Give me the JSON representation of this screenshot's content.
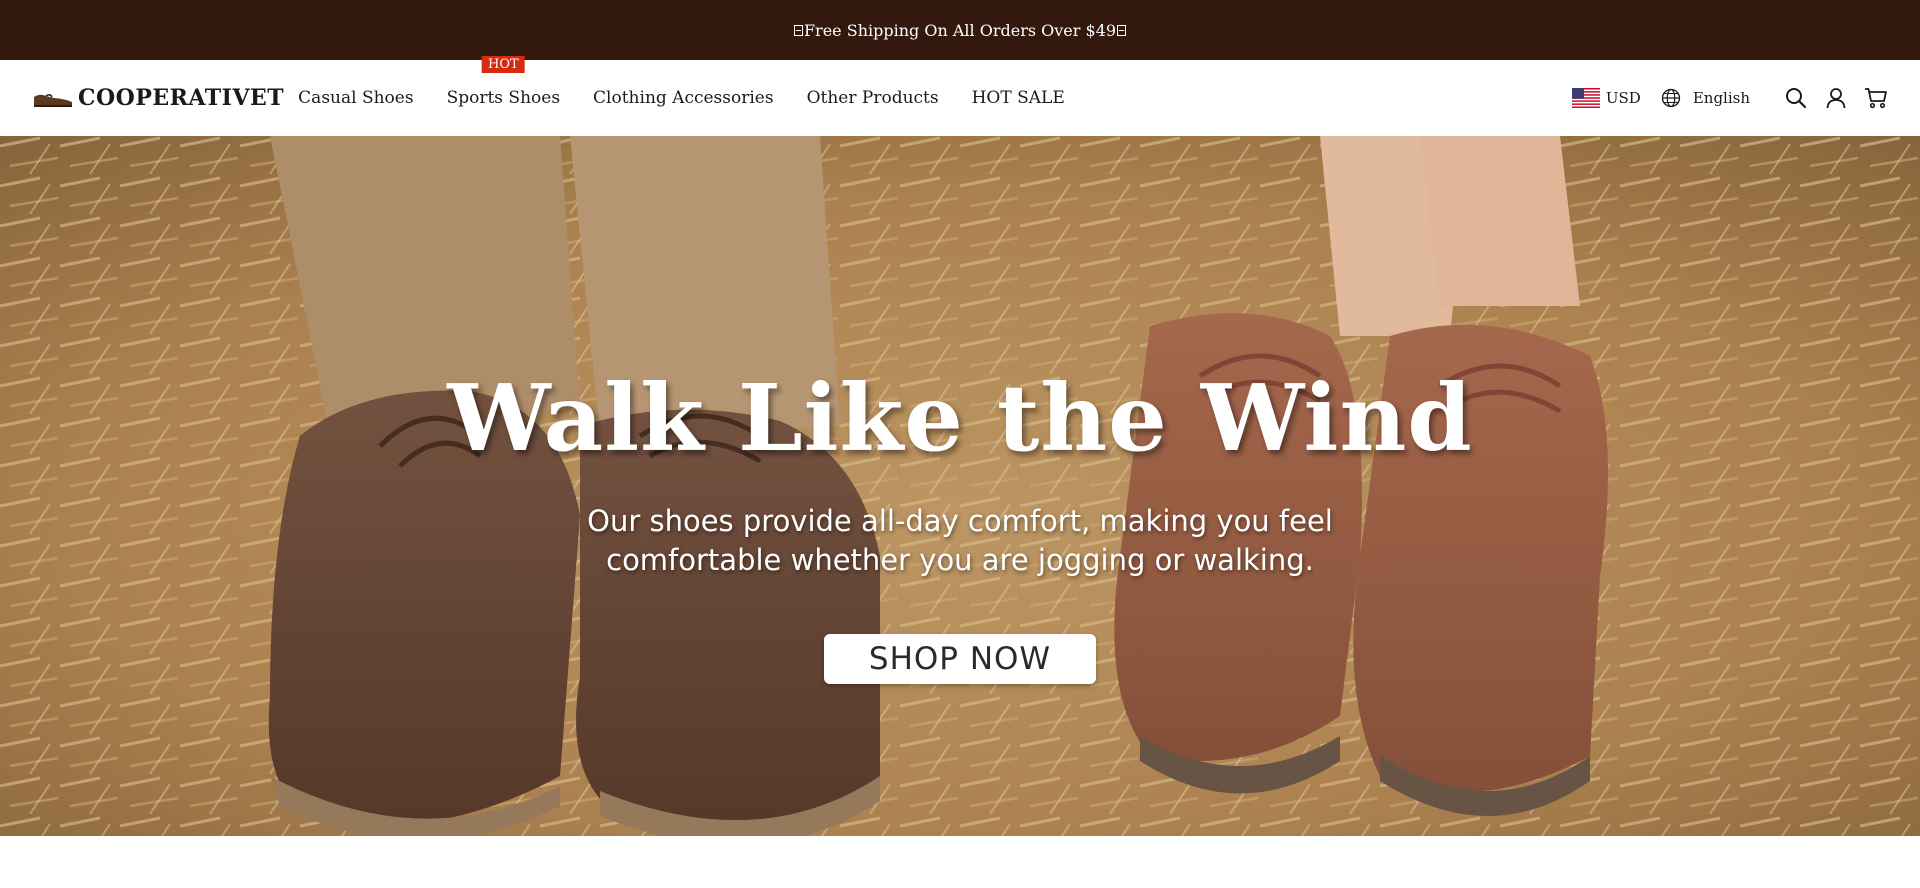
{
  "announcement": {
    "text": "Free Shipping On All Orders Over $49"
  },
  "header": {
    "brand": "COOPERATIVET",
    "nav": [
      {
        "label": "Casual Shoes"
      },
      {
        "label": "Sports Shoes",
        "badge": "HOT"
      },
      {
        "label": "Clothing Accessories"
      },
      {
        "label": "Other Products"
      },
      {
        "label": "HOT SALE"
      }
    ],
    "currency": "USD",
    "language": "English",
    "icons": [
      "globe-icon",
      "search-icon",
      "account-icon",
      "cart-icon"
    ]
  },
  "hero": {
    "title": "Walk Like the Wind",
    "subtitle": "Our shoes provide all-day comfort, making you feel comfortable whether you are jogging or walking.",
    "cta": "SHOP NOW"
  },
  "colors": {
    "announcement_bg": "#33180e",
    "hot_badge": "#d42b12",
    "text": "#1a1a1a"
  }
}
